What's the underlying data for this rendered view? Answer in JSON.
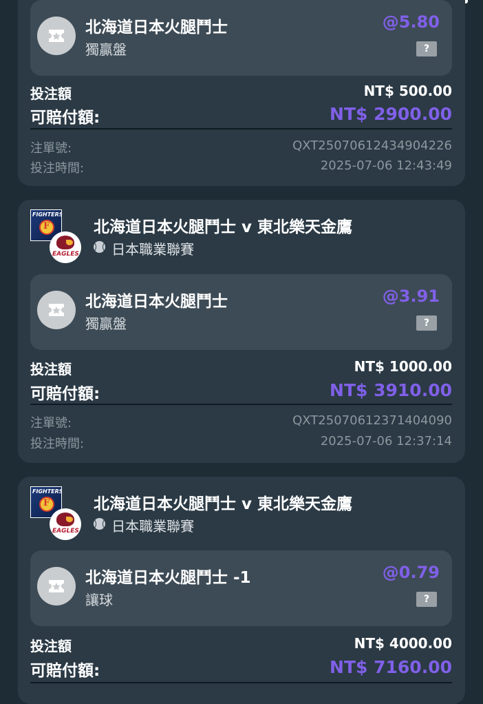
{
  "cards": [
    {
      "match_title": "",
      "league": "",
      "selection": "北海道日本火腿鬥士",
      "market": "獨贏盤",
      "odds": "@5.80",
      "stake_label": "投注額",
      "stake_value": "NT$ 500.00",
      "payout_label": "可賠付額:",
      "payout_value": "NT$ 2900.00",
      "order_label": "注單號:",
      "order_value": "QXT25070612434904226",
      "time_label": "投注時間:",
      "time_value": "2025-07-06 12:43:49"
    },
    {
      "match_title": "北海道日本火腿鬥士 v 東北樂天金鷹",
      "league": "日本職業聯賽",
      "selection": "北海道日本火腿鬥士",
      "market": "獨贏盤",
      "odds": "@3.91",
      "stake_label": "投注額",
      "stake_value": "NT$ 1000.00",
      "payout_label": "可賠付額:",
      "payout_value": "NT$ 3910.00",
      "order_label": "注單號:",
      "order_value": "QXT25070612371404090",
      "time_label": "投注時間:",
      "time_value": "2025-07-06 12:37:14"
    },
    {
      "match_title": "北海道日本火腿鬥士 v 東北樂天金鷹",
      "league": "日本職業聯賽",
      "selection": "北海道日本火腿鬥士 -1",
      "market": "讓球",
      "odds": "@0.79",
      "stake_label": "投注額",
      "stake_value": "NT$ 4000.00",
      "payout_label": "可賠付額:",
      "payout_value": "NT$ 7160.00"
    }
  ],
  "logos": {
    "home_text": "FIGHTERS",
    "away_text": "EAGLES"
  },
  "help_glyph": "?",
  "colors": {
    "background": "#1e2c36",
    "card": "#2b3a45",
    "bet_box": "#3d4b56",
    "accent_purple": "#8060e8",
    "muted_text": "#8d979e"
  },
  "icons": [
    "ticket-icon",
    "baseball-icon",
    "help-icon"
  ]
}
